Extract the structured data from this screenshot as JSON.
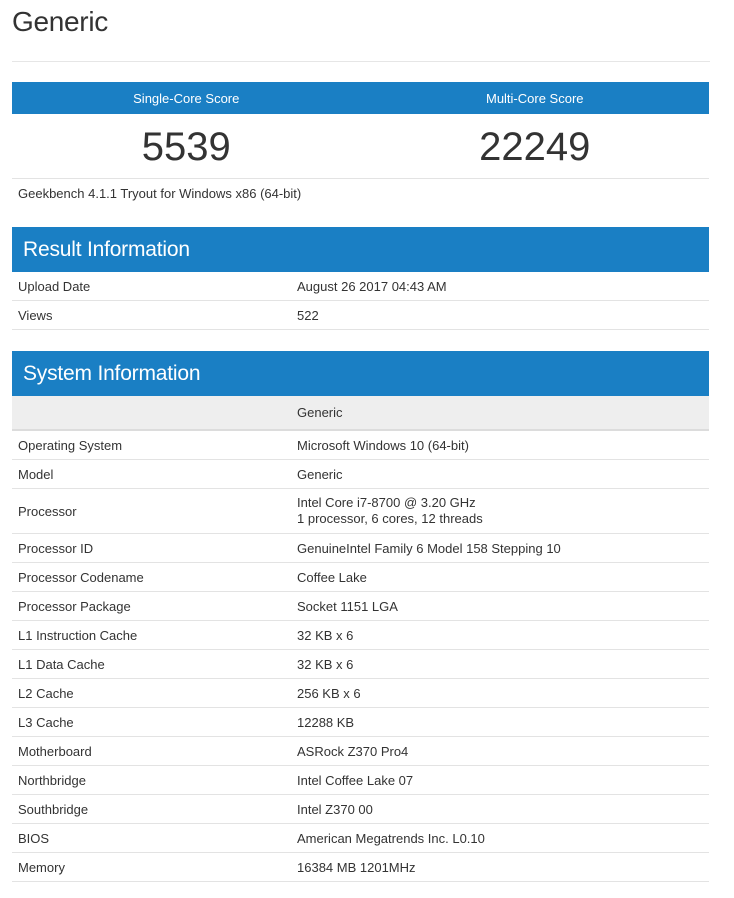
{
  "page": {
    "title": "Generic"
  },
  "scores": {
    "single_core_label": "Single-Core Score",
    "multi_core_label": "Multi-Core Score",
    "single_core_value": "5539",
    "multi_core_value": "22249",
    "version": "Geekbench 4.1.1 Tryout for Windows x86 (64-bit)"
  },
  "result_information": {
    "heading": "Result Information",
    "rows": [
      {
        "label": "Upload Date",
        "value": "August 26 2017 04:43 AM"
      },
      {
        "label": "Views",
        "value": "522"
      }
    ]
  },
  "system_information": {
    "heading": "System Information",
    "subheading": "Generic",
    "rows": [
      {
        "label": "Operating System",
        "value": "Microsoft Windows 10 (64-bit)"
      },
      {
        "label": "Model",
        "value": "Generic"
      },
      {
        "label": "Processor",
        "value": "Intel Core i7-8700 @ 3.20 GHz",
        "value_line2": "1 processor, 6 cores, 12 threads"
      },
      {
        "label": "Processor ID",
        "value": "GenuineIntel Family 6 Model 158 Stepping 10"
      },
      {
        "label": "Processor Codename",
        "value": "Coffee Lake"
      },
      {
        "label": "Processor Package",
        "value": "Socket 1151 LGA"
      },
      {
        "label": "L1 Instruction Cache",
        "value": "32 KB x 6"
      },
      {
        "label": "L1 Data Cache",
        "value": "32 KB x 6"
      },
      {
        "label": "L2 Cache",
        "value": "256 KB x 6"
      },
      {
        "label": "L3 Cache",
        "value": "12288 KB"
      },
      {
        "label": "Motherboard",
        "value": "ASRock Z370 Pro4"
      },
      {
        "label": "Northbridge",
        "value": "Intel Coffee Lake 07"
      },
      {
        "label": "Southbridge",
        "value": "Intel Z370 00"
      },
      {
        "label": "BIOS",
        "value": "American Megatrends Inc. L0.10"
      },
      {
        "label": "Memory",
        "value": "16384 MB 1201MHz"
      }
    ]
  },
  "colors": {
    "header_blue": "#1a7fc4",
    "text": "#333333",
    "row_border": "#e3e3e3",
    "subheader_bg": "#eeeeee"
  }
}
